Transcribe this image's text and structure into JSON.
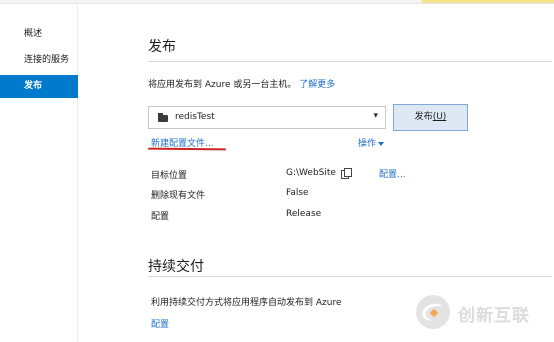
{
  "sidebar": {
    "items": [
      {
        "label": "概述"
      },
      {
        "label": "连接的服务"
      },
      {
        "label": "发布"
      }
    ]
  },
  "publish": {
    "title": "发布",
    "description": "将应用发布到 Azure 或另一台主机。",
    "learn_more": "了解更多",
    "profile_select_value": "redisTest",
    "publish_button_label": "发布",
    "publish_button_accel": "(U)",
    "new_profile_link": "新建配置文件...",
    "operations_link": "操作",
    "properties": [
      {
        "label": "目标位置",
        "value": "G:\\WebSite"
      },
      {
        "label": "删除现有文件",
        "value": "False"
      },
      {
        "label": "配置",
        "value": "Release"
      }
    ],
    "configure_link": "配置..."
  },
  "continuous_delivery": {
    "title": "持续交付",
    "description": "利用持续交付方式将应用程序自动发布到 Azure",
    "configure_link": "配置"
  },
  "watermark": {
    "text": "创新互联"
  },
  "colors": {
    "accent": "#007acc",
    "link": "#1e6fc8",
    "annotation_underline": "#cc2222"
  }
}
